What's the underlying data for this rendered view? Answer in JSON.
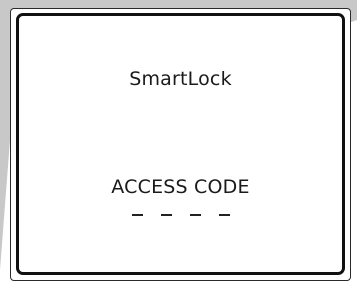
{
  "device": {
    "title": "SmartLock",
    "prompt_label": "ACCESS CODE",
    "code_slots": [
      "",
      "",
      "",
      ""
    ]
  },
  "colors": {
    "bezel_gray": "#c8c8c8",
    "border": "#111111",
    "text": "#1a1a1a",
    "background": "#ffffff"
  }
}
